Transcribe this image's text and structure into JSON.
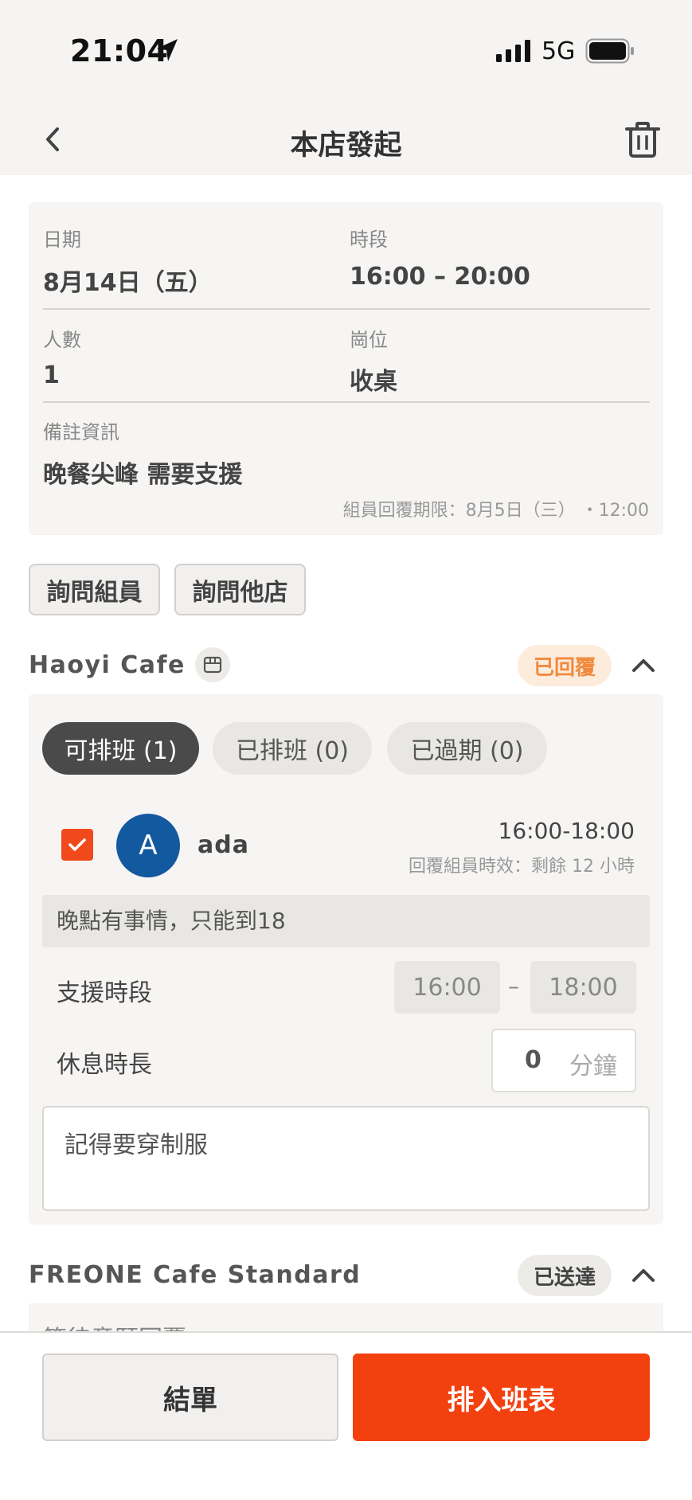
{
  "status_bar": {
    "time": "21:04",
    "network": "5G"
  },
  "nav": {
    "title": "本店發起"
  },
  "info": {
    "date_label": "日期",
    "date_value": "8月14日（五）",
    "period_label": "時段",
    "period_value": "16:00 – 20:00",
    "count_label": "人數",
    "count_value": "1",
    "position_label": "崗位",
    "position_value": "收桌",
    "notes_label": "備註資訊",
    "notes_value": "晚餐尖峰 需要支援",
    "deadline": "組員回覆期限：8月5日（三） ・12:00"
  },
  "actions": {
    "ask_members": "詢問組員",
    "ask_other_stores": "詢問他店"
  },
  "stores": [
    {
      "name": "Haoyi Cafe",
      "status": "已回覆",
      "tabs": [
        {
          "label": "可排班 (1)"
        },
        {
          "label": "已排班 (0)"
        },
        {
          "label": "已過期 (0)"
        }
      ],
      "member": {
        "avatar_letter": "A",
        "name": "ada",
        "time": "16:00-18:00",
        "expire": "回覆組員時效：剩餘 12 小時",
        "reply": "晚點有事情，只能到18",
        "support_label": "支援時段",
        "support_start": "16:00",
        "support_dash": "–",
        "support_end": "18:00",
        "break_label": "休息時長",
        "break_value": "0",
        "break_unit": "分鐘",
        "note": "記得要穿制服",
        "selected": true
      }
    },
    {
      "name": "FREONE Cafe Standard",
      "status": "已送達",
      "preview_text": "等待意願回覆"
    }
  ],
  "bottom": {
    "close_label": "結單",
    "schedule_label": "排入班表"
  },
  "colors": {
    "accent": "#f3400f",
    "avatar": "#1359a0",
    "replied_badge": "#fdebdc"
  }
}
